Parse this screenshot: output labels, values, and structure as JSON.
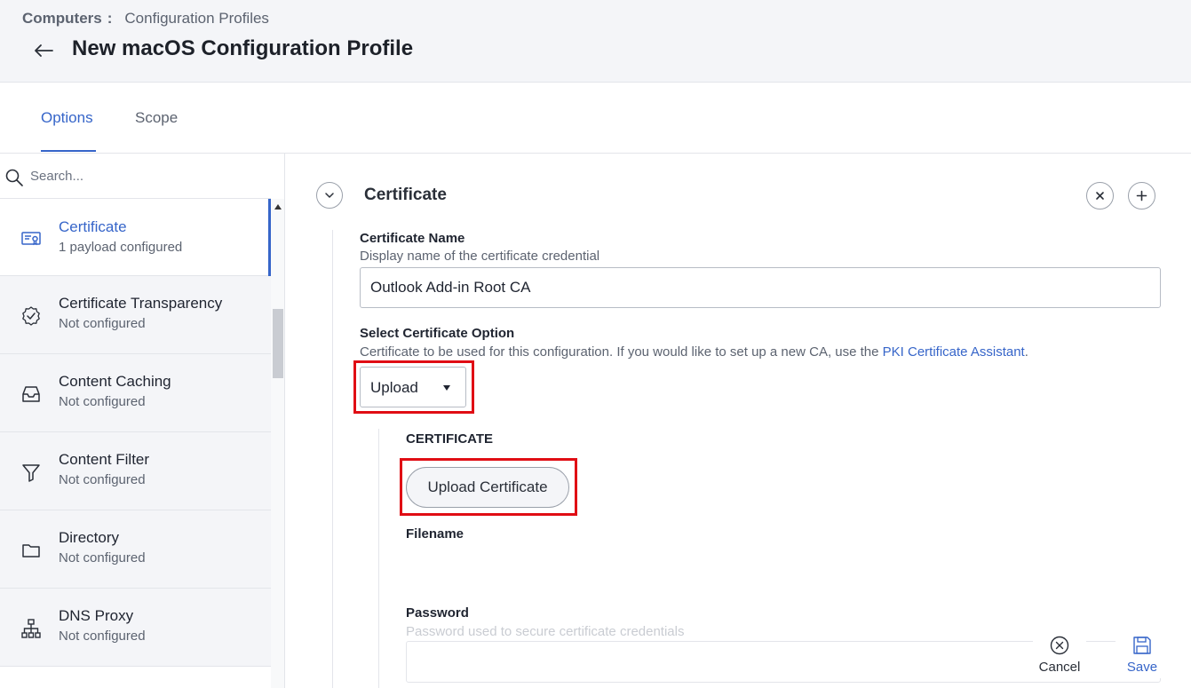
{
  "header": {
    "breadcrumb_root": "Computers",
    "breadcrumb_sep": ":",
    "breadcrumb_current": "Configuration Profiles",
    "title": "New macOS Configuration Profile"
  },
  "tabs": [
    {
      "label": "Options",
      "active": true
    },
    {
      "label": "Scope",
      "active": false
    }
  ],
  "sidebar": {
    "search_placeholder": "Search...",
    "items": [
      {
        "title": "Certificate",
        "status": "1 payload configured",
        "icon": "certificate-icon",
        "active": true
      },
      {
        "title": "Certificate Transparency",
        "status": "Not configured",
        "icon": "badge-check-icon",
        "active": false
      },
      {
        "title": "Content Caching",
        "status": "Not configured",
        "icon": "inbox-icon",
        "active": false
      },
      {
        "title": "Content Filter",
        "status": "Not configured",
        "icon": "filter-icon",
        "active": false
      },
      {
        "title": "Directory",
        "status": "Not configured",
        "icon": "folder-icon",
        "active": false
      },
      {
        "title": "DNS Proxy",
        "status": "Not configured",
        "icon": "network-icon",
        "active": false
      }
    ]
  },
  "main": {
    "section_title": "Certificate",
    "cert_name_label": "Certificate Name",
    "cert_name_help": "Display name of the certificate credential",
    "cert_name_value": "Outlook Add-in Root CA",
    "select_label": "Select Certificate Option",
    "select_help_prefix": "Certificate to be used for this configuration. If you would like to set up a new CA, use the ",
    "select_help_link": "PKI Certificate Assistant",
    "select_help_suffix": ".",
    "select_value": "Upload",
    "certificate_heading": "CERTIFICATE",
    "upload_button": "Upload Certificate",
    "filename_label": "Filename",
    "password_label": "Password",
    "password_help": "Password used to secure certificate credentials"
  },
  "actions": {
    "cancel": "Cancel",
    "save": "Save"
  },
  "colors": {
    "accent": "#3665c9",
    "highlight": "#e00d14"
  }
}
